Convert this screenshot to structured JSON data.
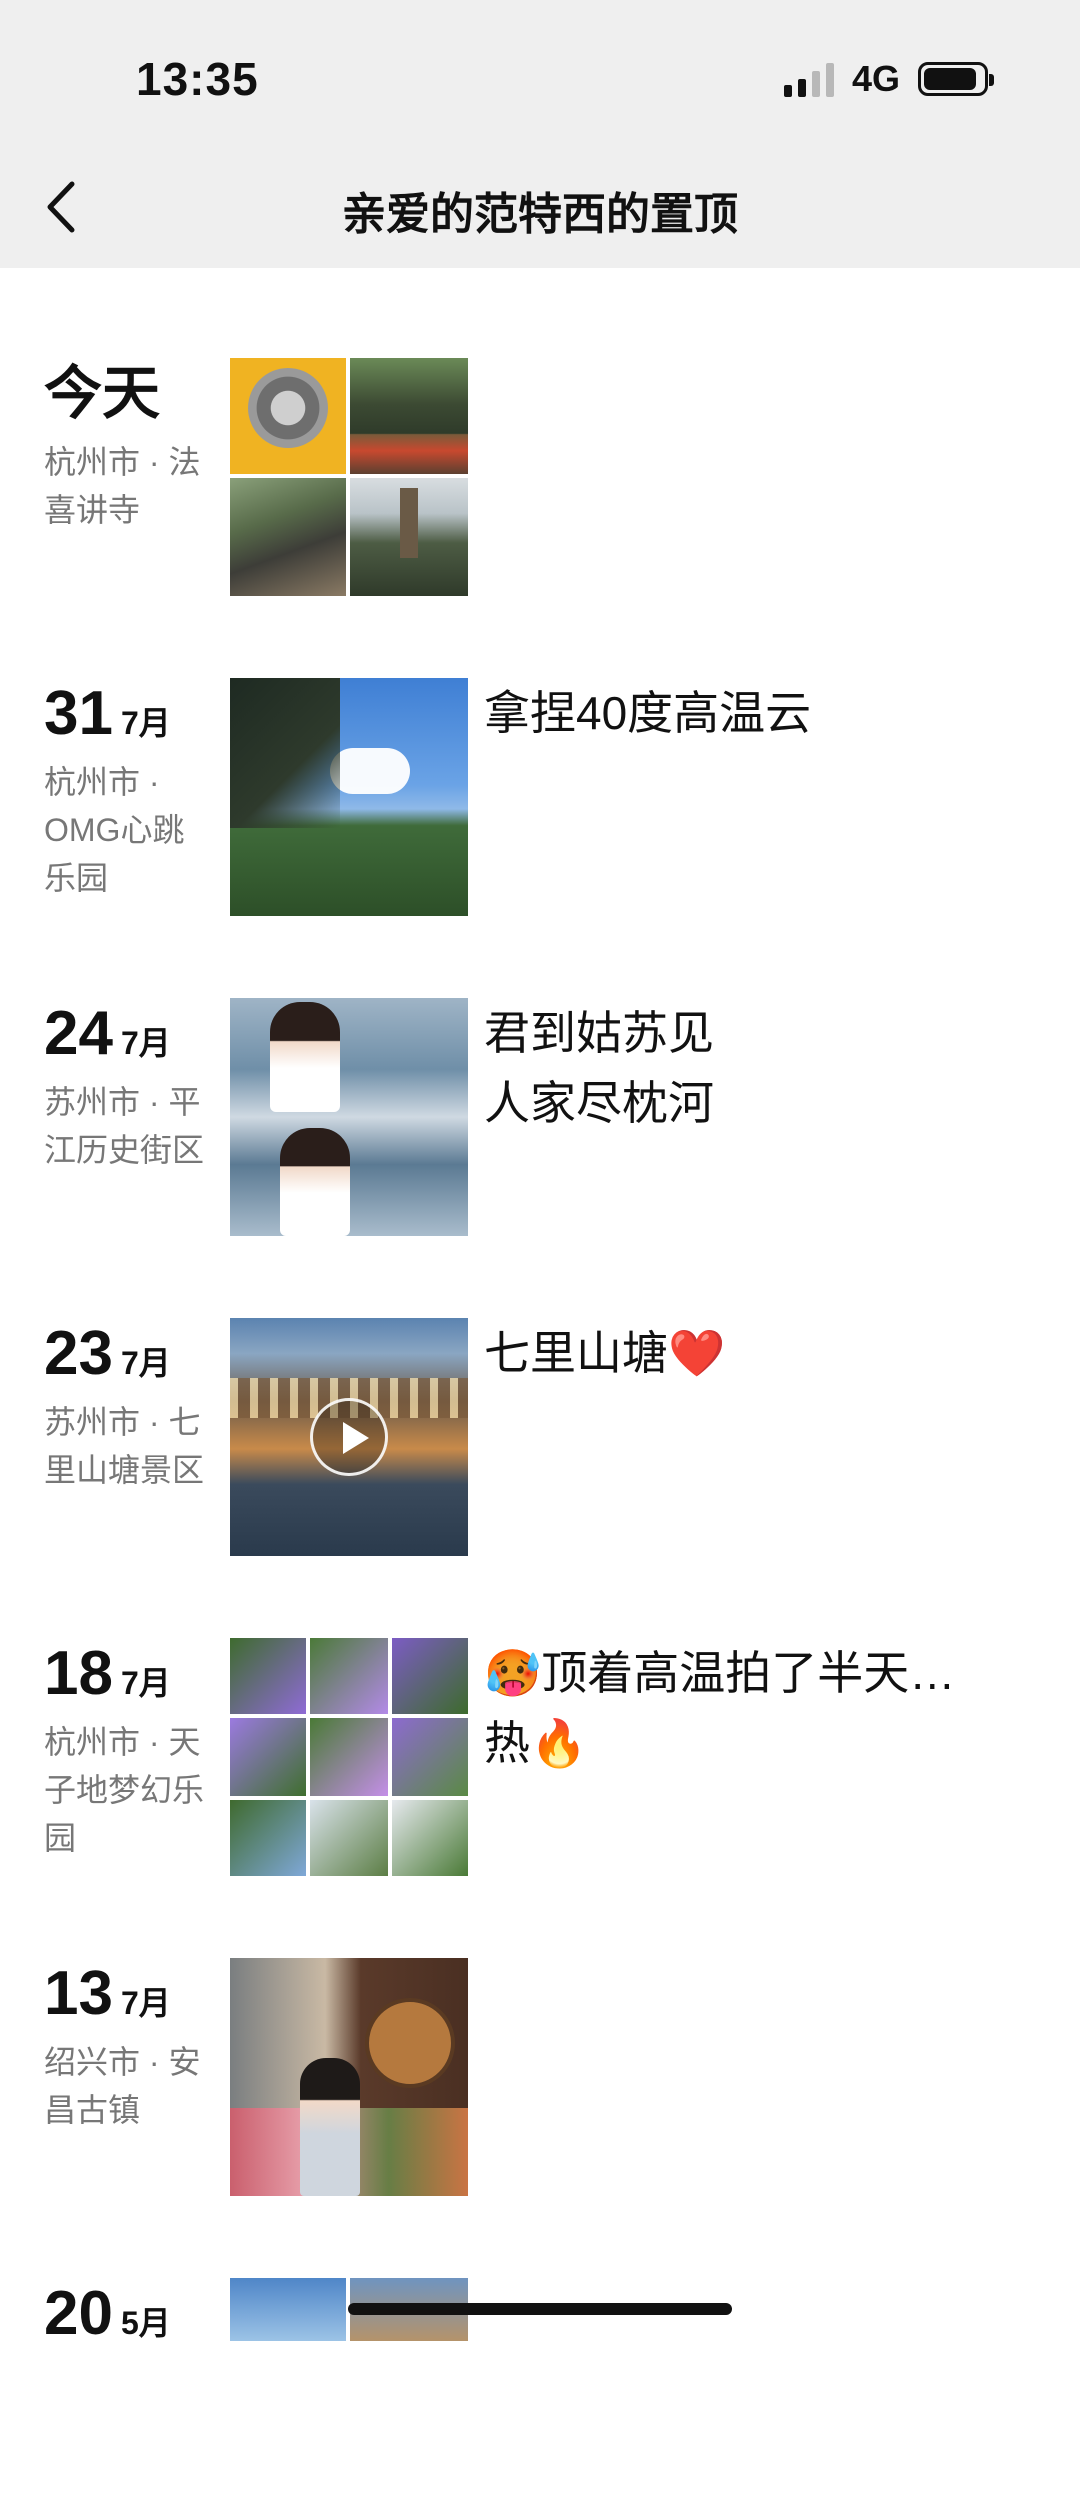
{
  "status_bar": {
    "time": "13:35",
    "network": "4G"
  },
  "nav": {
    "title": "亲爱的范特西的置顶"
  },
  "entries": [
    {
      "day": "今天",
      "month": "",
      "location": "杭州市 · 法喜讲寺",
      "caption": ""
    },
    {
      "day": "31",
      "month": "7月",
      "location": "杭州市 · OMG心跳乐园",
      "caption": "拿捏40度高温云"
    },
    {
      "day": "24",
      "month": "7月",
      "location": "苏州市 · 平江历史街区",
      "caption": "君到姑苏见\n人家尽枕河"
    },
    {
      "day": "23",
      "month": "7月",
      "location": "苏州市 · 七里山塘景区",
      "caption": "七里山塘❤️"
    },
    {
      "day": "18",
      "month": "7月",
      "location": "杭州市 · 天子地梦幻乐园",
      "caption": "🥵顶着高温拍了半天…\n热🔥"
    },
    {
      "day": "13",
      "month": "7月",
      "location": "绍兴市 · 安昌古镇",
      "caption": ""
    },
    {
      "day": "20",
      "month": "5月",
      "location": "",
      "caption": ""
    }
  ],
  "colors": {
    "topbar_bg": "#efefef",
    "page_bg": "#ffffff",
    "location_text": "#777777"
  }
}
